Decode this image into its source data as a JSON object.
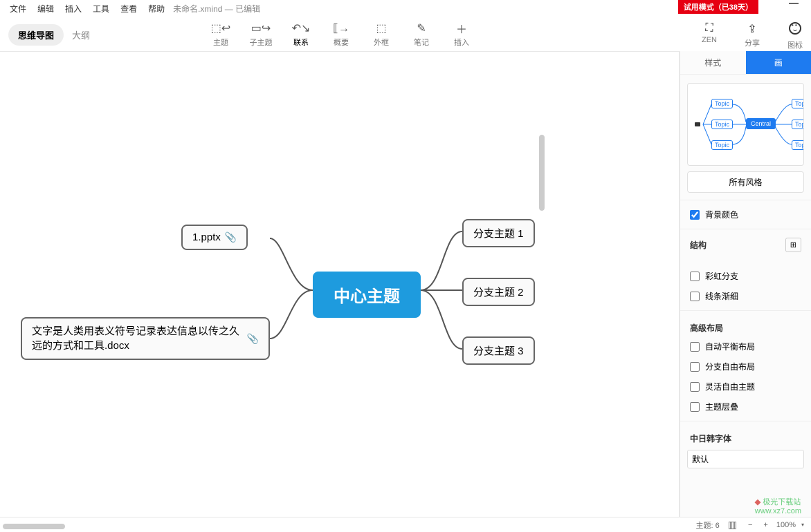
{
  "menu": {
    "items": [
      "文件",
      "编辑",
      "插入",
      "工具",
      "查看",
      "帮助"
    ],
    "filename": "未命名.xmind",
    "status": "— 已编辑"
  },
  "trial_badge": "试用模式（已38天）",
  "modes": {
    "mindmap": "思维导图",
    "outline": "大纲"
  },
  "toolbar": {
    "items": [
      {
        "icon": "⬚↩",
        "label": "主题"
      },
      {
        "icon": "▭↪",
        "label": "子主题"
      },
      {
        "icon": "↶↘",
        "label": "联系"
      },
      {
        "icon": "⟦→",
        "label": "概要"
      },
      {
        "icon": "⬚",
        "label": "外框"
      },
      {
        "icon": "✎",
        "label": "笔记"
      },
      {
        "icon": "＋",
        "label": "插入"
      }
    ],
    "zen": {
      "icon": "⛶",
      "label": "ZEN"
    },
    "share": {
      "icon": "⇪",
      "label": "分享"
    },
    "iconlib": {
      "icon": "☺",
      "label": "图标"
    }
  },
  "mindmap": {
    "central": "中心主题",
    "left": [
      {
        "text": "1.pptx",
        "has_attachment": true
      },
      {
        "text": "文字是人类用表义符号记录表达信息以传之久远的方式和工具.docx",
        "has_attachment": true
      }
    ],
    "right": [
      {
        "text": "分支主题 1"
      },
      {
        "text": "分支主题 2"
      },
      {
        "text": "分支主题 3"
      }
    ]
  },
  "panel": {
    "tabs": {
      "style": "样式",
      "active_partial": "画"
    },
    "preview": {
      "central": "Central",
      "topic": "Topic"
    },
    "all_styles": "所有风格",
    "bg_color": "背景颜色",
    "structure": "结构",
    "rainbow": "彩虹分支",
    "thin_lines": "线条渐细",
    "adv_layout": "高级布局",
    "auto_balance": "自动平衡布局",
    "free_branch": "分支自由布局",
    "flex_topic": "灵活自由主题",
    "topic_stack": "主题层叠",
    "cjk_font": "中日韩字体",
    "font_value": "默认"
  },
  "status": {
    "topic_count_label": "主题:",
    "topic_count": "6",
    "zoom": "100%"
  },
  "watermark": {
    "line1": "极光下载站",
    "line2": "www.xz7.com"
  }
}
